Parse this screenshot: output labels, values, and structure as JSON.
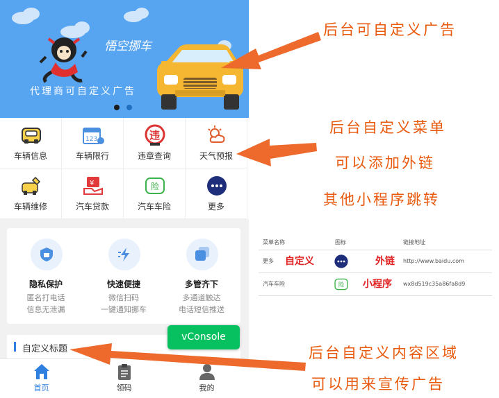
{
  "banner": {
    "brand": "悟空挪车",
    "caption": "代理商可自定义广告"
  },
  "menu": {
    "items": [
      {
        "label": "车辆信息",
        "icon": "car-info-icon"
      },
      {
        "label": "车辆限行",
        "icon": "calendar-limit-icon"
      },
      {
        "label": "违章查询",
        "icon": "violation-icon"
      },
      {
        "label": "天气预报",
        "icon": "weather-icon"
      },
      {
        "label": "车辆维修",
        "icon": "repair-icon"
      },
      {
        "label": "汽车贷款",
        "icon": "loan-icon"
      },
      {
        "label": "汽车车险",
        "icon": "insurance-icon"
      },
      {
        "label": "更多",
        "icon": "more-icon"
      }
    ]
  },
  "features": [
    {
      "title": "隐私保护",
      "line1": "匿名打电话",
      "line2": "信息无泄漏",
      "icon": "shield-icon"
    },
    {
      "title": "快速便捷",
      "line1": "微信扫码",
      "line2": "一键通知挪车",
      "icon": "lightning-icon"
    },
    {
      "title": "多管齐下",
      "line1": "多通道触达",
      "line2": "电话短信推送",
      "icon": "layers-icon"
    }
  ],
  "section": {
    "title": "自定义标题"
  },
  "vconsole": {
    "label": "vConsole"
  },
  "tabbar": {
    "tabs": [
      {
        "label": "首页",
        "icon": "home-icon",
        "active": true
      },
      {
        "label": "领码",
        "icon": "clipboard-icon",
        "active": false
      },
      {
        "label": "我的",
        "icon": "user-icon",
        "active": false
      }
    ]
  },
  "annotations": {
    "ad": "后台可自定义广告",
    "menu": "后台自定义菜单",
    "link": "可以添加外链",
    "mini": "其他小程序跳转",
    "content": "后台自定义内容区域",
    "promo": "可以用来宣传广告"
  },
  "config_table": {
    "headers": [
      "菜单名称",
      "图标",
      "链接地址"
    ],
    "rows": [
      {
        "name": "更多",
        "tag_name": "自定义",
        "tag_link": "外链",
        "link": "http://www.baidu.com",
        "icon": "more-icon"
      },
      {
        "name": "汽车车险",
        "tag_name": "",
        "tag_link": "小程序",
        "link": "wx8d519c35a86fa8d9",
        "icon": "insurance-icon"
      }
    ]
  },
  "colors": {
    "banner_bg": "#57a4f1",
    "accent": "#2f7fe0",
    "annotation": "#e8590c",
    "vconsole": "#07c160",
    "tag_red": "#e02020"
  }
}
